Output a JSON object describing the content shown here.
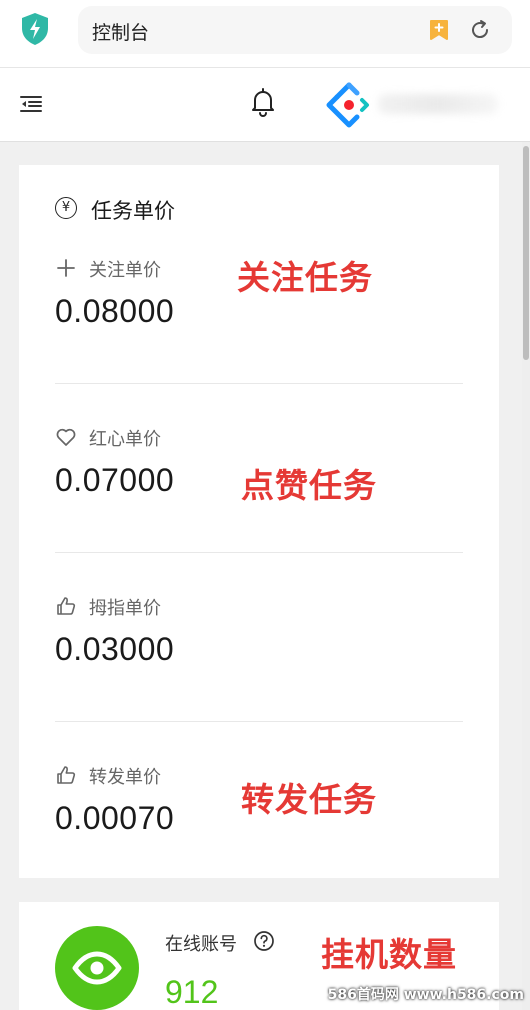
{
  "browser": {
    "address_text": "控制台"
  },
  "price_card": {
    "title": "任务单价",
    "currency_symbol": "¥",
    "items": [
      {
        "icon": "plus-icon",
        "label": "关注单价",
        "value": "0.08000",
        "annotation": "关注任务"
      },
      {
        "icon": "heart-icon",
        "label": "红心单价",
        "value": "0.07000",
        "annotation": "点赞任务"
      },
      {
        "icon": "thumbs-up-icon",
        "label": "拇指单价",
        "value": "0.03000",
        "annotation": ""
      },
      {
        "icon": "thumbs-up-icon",
        "label": "转发单价",
        "value": "0.00070",
        "annotation": "转发任务"
      }
    ]
  },
  "online_card": {
    "label": "在线账号",
    "value": "912",
    "annotation": "挂机数量"
  },
  "watermark": "586首码网 www.h586.com",
  "colors": {
    "accent_green": "#52c41a",
    "annotation_red": "#e53935",
    "shield_teal": "#2fb8a6",
    "bookmark_orange": "#f7b33d",
    "logo_blue": "#1890ff"
  }
}
